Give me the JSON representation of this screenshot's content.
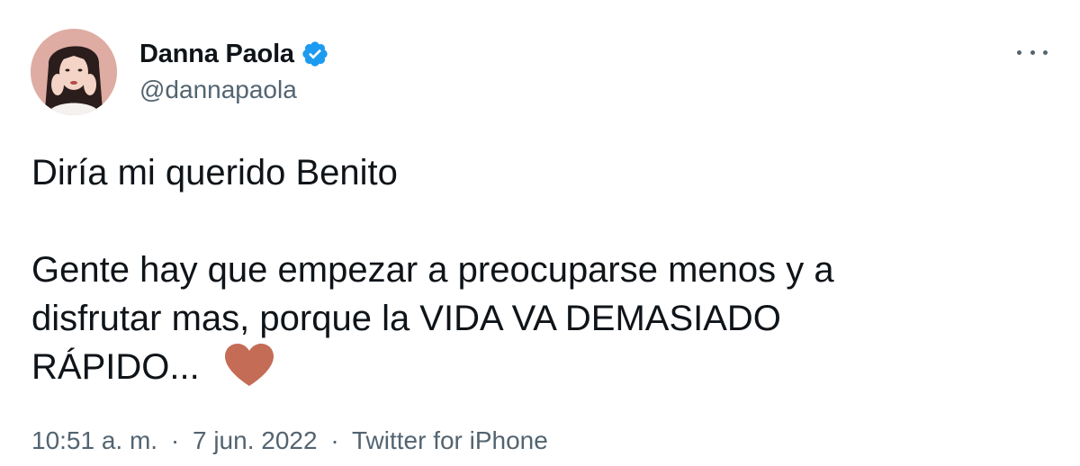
{
  "author": {
    "name": "Danna Paola",
    "handle": "@dannapaola",
    "verified": true,
    "avatar_icon": "profile-photo"
  },
  "tweet": {
    "line1": "Diría mi querido Benito",
    "line2": "Gente hay que empezar a preocuparse menos y a",
    "line3": "disfrutar mas, porque la VIDA VA DEMASIADO",
    "line4": "RÁPIDO...",
    "emoji": "brown-heart-icon"
  },
  "meta": {
    "time": "10:51 a. m.",
    "separator": "·",
    "date": "7 jun. 2022",
    "source": "Twitter for iPhone"
  },
  "colors": {
    "text_primary": "#0f1419",
    "text_secondary": "#536471",
    "verified_blue": "#1d9bf0",
    "heart": "#c46c55"
  },
  "icons": {
    "more": "more-horizontal-icon",
    "verified": "verified-badge-icon"
  }
}
